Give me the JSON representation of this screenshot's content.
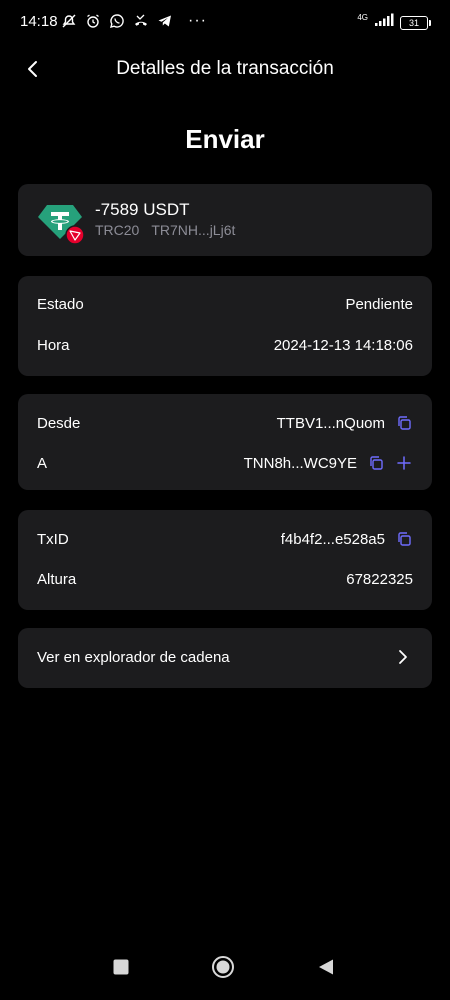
{
  "status_bar": {
    "time": "14:18",
    "icons_left": [
      "mute-icon",
      "alarm-icon",
      "whatsapp-icon",
      "missed-call-icon",
      "telegram-icon"
    ],
    "more": "···",
    "network": "4G",
    "battery": "31"
  },
  "header": {
    "back": "back-arrow-icon",
    "title": "Detalles de la transacción"
  },
  "page_title": "Enviar",
  "asset": {
    "amount": "-7589 USDT",
    "network": "TRC20",
    "address": "TR7NH...jLj6t",
    "token_icon": "tether-icon",
    "chain_badge_icon": "tron-icon"
  },
  "status": {
    "estado_label": "Estado",
    "estado_value": "Pendiente",
    "hora_label": "Hora",
    "hora_value": "2024-12-13 14:18:06"
  },
  "addresses": {
    "desde_label": "Desde",
    "desde_value": "TTBV1...nQuom",
    "a_label": "A",
    "a_value": "TNN8h...WC9YE"
  },
  "tx": {
    "txid_label": "TxID",
    "txid_value": "f4b4f2...e528a5",
    "altura_label": "Altura",
    "altura_value": "67822325"
  },
  "explorer": {
    "label": "Ver en explorador de cadena"
  },
  "colors": {
    "background": "#000000",
    "card": "#1c1c1e",
    "pending": "#ff4b4b",
    "accent": "#6f6cff",
    "tether": "#26a17b",
    "tron": "#e5002c",
    "muted_text": "#8c8c96"
  }
}
